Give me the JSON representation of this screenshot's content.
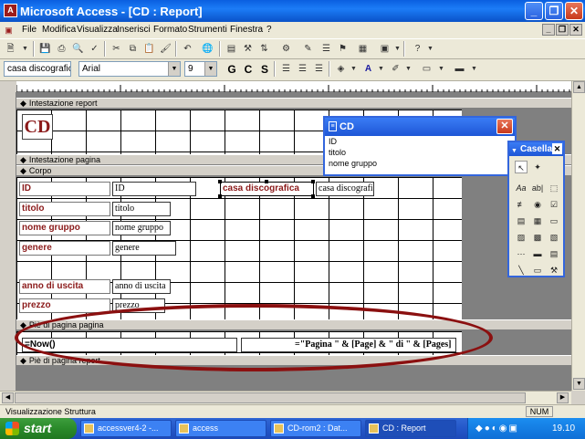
{
  "window": {
    "title": "Microsoft Access - [CD : Report]"
  },
  "menu": [
    "File",
    "Modifica",
    "Visualizza",
    "Inserisci",
    "Formato",
    "Strumenti",
    "Finestra",
    "?"
  ],
  "format_bar": {
    "object": "casa discografic",
    "font": "Arial",
    "size": "9",
    "bold": "G",
    "italic": "C",
    "underline": "S"
  },
  "sections": {
    "report_header": "Intestazione report",
    "page_header": "Intestazione pagina",
    "body": "Corpo",
    "page_footer": "Piè di pagina pagina",
    "report_footer": "Piè di pagina report"
  },
  "report_header": {
    "title": "CD"
  },
  "body_controls": [
    {
      "label": "ID",
      "field": "ID"
    },
    {
      "label": "titolo",
      "field": "titolo"
    },
    {
      "label": "nome gruppo",
      "field": "nome gruppo"
    },
    {
      "label": "genere",
      "field": "genere"
    },
    {
      "label": "anno di uscita",
      "field": "anno di uscita"
    },
    {
      "label": "prezzo",
      "field": "prezzo"
    }
  ],
  "selected_control": {
    "label": "casa discografica",
    "field": "casa discografica"
  },
  "page_footer": {
    "date": "=Now()",
    "pages": "=\"Pagina \" & [Page] & \" di \" & [Pages]"
  },
  "field_list": {
    "title": "CD",
    "fields": [
      "ID",
      "titolo",
      "nome gruppo"
    ]
  },
  "toolbox": {
    "title": "Casella"
  },
  "status": {
    "left": "Visualizzazione Struttura",
    "num": "NUM"
  },
  "taskbar": {
    "start": "start",
    "tasks": [
      "accessver4-2 -...",
      "access",
      "CD-rom2 : Dat...",
      "CD : Report"
    ],
    "clock": "19.10"
  },
  "colors": {
    "annotation": "#8b1010",
    "label_text": "#8b1a1a",
    "title_bar": "#0a5fe0"
  }
}
